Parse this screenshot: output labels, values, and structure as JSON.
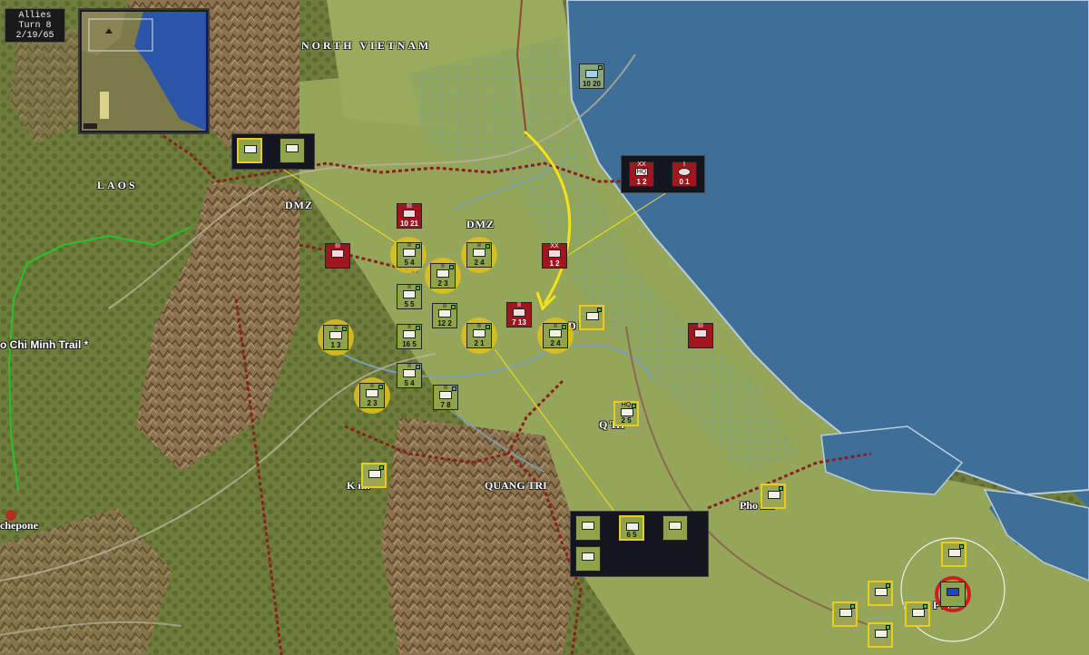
{
  "hud": {
    "side": "Allies",
    "turn": "Turn 8",
    "date": "2/19/65"
  },
  "map_labels": {
    "north_vietnam": "NORTH VIETNAM",
    "laos": "LAOS",
    "dmz_left": "DMZ",
    "dmz_right": "DMZ",
    "ho_chi_minh_trail": "o Chi Minh Trail *",
    "dong_ha": "D     Ha",
    "quang_tri_city": "Q     Tri",
    "quang_tri_province": "QUANG TRI",
    "khe_sanh": "K     nh",
    "tchepone": "chepone",
    "phong_dien": "Pho     ien",
    "hue": "P     ai"
  },
  "colors": {
    "us_unit": "#8fa44a",
    "arvn_unit": "#9aa653",
    "nva_unit": "#a0161e",
    "selection_halo": "#e0c21a",
    "sea": "#3f6f99",
    "border_line": "#8a1f1f",
    "move_arrow": "#f5e21a"
  },
  "units": [
    {
      "id": "u1",
      "faction": "us",
      "size": "II",
      "strength": "5 4",
      "symbol": "infantry-icon"
    },
    {
      "id": "u2",
      "faction": "us",
      "size": "II",
      "strength": "2 3",
      "symbol": "armor-icon"
    },
    {
      "id": "u3",
      "faction": "us",
      "size": "II",
      "strength": "2 4",
      "symbol": "armor-icon"
    },
    {
      "id": "u4",
      "faction": "us",
      "size": "II",
      "strength": "5 5",
      "symbol": "infantry-icon"
    },
    {
      "id": "u5",
      "faction": "us",
      "size": "II",
      "strength": "12 2",
      "symbol": "artillery-icon"
    },
    {
      "id": "u6",
      "faction": "us",
      "size": "II",
      "strength": "2 1",
      "symbol": "artillery-icon"
    },
    {
      "id": "u7",
      "faction": "us",
      "size": "II",
      "strength": "2 4",
      "symbol": "armor-icon"
    },
    {
      "id": "u8",
      "faction": "us",
      "size": "II",
      "strength": "16 5",
      "symbol": "recon-icon"
    },
    {
      "id": "u9",
      "faction": "us",
      "size": "II",
      "strength": "5 4",
      "symbol": "infantry-icon"
    },
    {
      "id": "u10",
      "faction": "us",
      "size": "II",
      "strength": "1 3",
      "symbol": "infantry-icon"
    },
    {
      "id": "u11",
      "faction": "us",
      "size": "II",
      "strength": "2 3",
      "symbol": "infantry-icon"
    },
    {
      "id": "u12",
      "faction": "us",
      "size": "II",
      "strength": "7 8",
      "symbol": "airborne-icon"
    },
    {
      "id": "u13",
      "faction": "arvn",
      "size": "HQ",
      "strength": "2 5",
      "symbol": "hq-icon"
    },
    {
      "id": "u14",
      "faction": "arvn",
      "size": "II",
      "strength": "",
      "symbol": "infantry-icon"
    },
    {
      "id": "u15",
      "faction": "arvn",
      "size": "II",
      "strength": "",
      "symbol": "infantry-icon"
    },
    {
      "id": "u16",
      "faction": "arvn",
      "size": "II",
      "strength": "",
      "symbol": "infantry-icon"
    },
    {
      "id": "u17",
      "faction": "arvn",
      "size": "II",
      "strength": "",
      "symbol": "infantry-icon"
    },
    {
      "id": "u18",
      "faction": "arvn",
      "size": "II",
      "strength": "",
      "symbol": "infantry-icon"
    },
    {
      "id": "u19",
      "faction": "arvn",
      "size": "II",
      "strength": "",
      "symbol": "infantry-icon"
    },
    {
      "id": "u20",
      "faction": "arvn",
      "size": "II",
      "strength": "",
      "symbol": "artillery-icon"
    },
    {
      "id": "u21",
      "faction": "arvn",
      "size": "II",
      "strength": "",
      "symbol": "infantry-icon"
    },
    {
      "id": "u22",
      "faction": "nva",
      "size": "III",
      "strength": "10 21",
      "symbol": "infantry-icon"
    },
    {
      "id": "u23",
      "faction": "nva",
      "size": "III",
      "strength": "",
      "symbol": "artillery-icon"
    },
    {
      "id": "u24",
      "faction": "nva",
      "size": "XX",
      "strength": "1 2",
      "symbol": "hq-icon"
    },
    {
      "id": "u25",
      "faction": "nva",
      "size": "II",
      "strength": "7 13",
      "symbol": "infantry-icon"
    },
    {
      "id": "u26",
      "faction": "nva",
      "size": "III",
      "strength": "",
      "symbol": "artillery-icon"
    },
    {
      "id": "u27",
      "faction": "naval",
      "size": "",
      "strength": "10 20",
      "symbol": "ship-icon"
    }
  ],
  "stacks": [
    {
      "id": "s1",
      "units": [
        {
          "strength": "",
          "faction": "us"
        },
        {
          "strength": "",
          "faction": "us"
        }
      ]
    },
    {
      "id": "s2",
      "units": [
        {
          "size": "XX",
          "strength": "1 2",
          "faction": "nva",
          "symbol": "HQ"
        },
        {
          "size": "I",
          "strength": "0 1",
          "faction": "nva",
          "symbol": "mortar"
        }
      ]
    },
    {
      "id": "s3",
      "units": [
        {
          "strength": "",
          "faction": "us"
        },
        {
          "strength": "6 5",
          "faction": "us"
        },
        {
          "strength": "",
          "faction": "us"
        },
        {
          "strength": "",
          "faction": "us"
        }
      ]
    }
  ]
}
